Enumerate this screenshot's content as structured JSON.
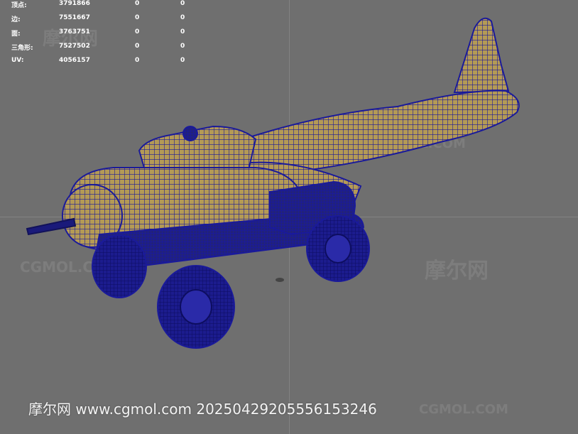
{
  "stats_hud": {
    "rows": [
      {
        "label": "顶点:",
        "total": "3791866",
        "sel1": "0",
        "sel2": "0"
      },
      {
        "label": "边:",
        "total": "7551667",
        "sel1": "0",
        "sel2": "0"
      },
      {
        "label": "面:",
        "total": "3763751",
        "sel1": "0",
        "sel2": "0"
      },
      {
        "label": "三角形:",
        "total": "7527502",
        "sel1": "0",
        "sel2": "0"
      },
      {
        "label": "UV:",
        "total": "4056157",
        "sel1": "0",
        "sel2": "0"
      }
    ]
  },
  "watermarks": {
    "site_cn": "摩尔网",
    "site_en": "CGMOL.COM"
  },
  "footer": {
    "text": "摩尔网 www.cgmol.com 20250429205556153246"
  },
  "colors": {
    "background": "#6f6f6f",
    "wireframe": "#1a1a9a",
    "surface": "#b49a55",
    "hud_text": "#ffffff"
  },
  "model": {
    "icon": "wireframe-vehicle-icon"
  }
}
